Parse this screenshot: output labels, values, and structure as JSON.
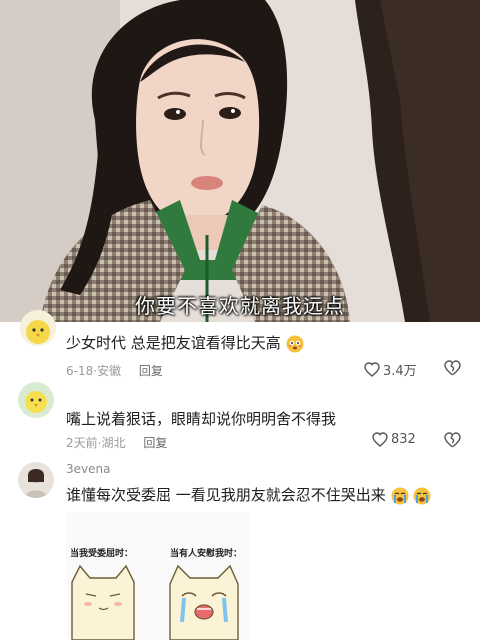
{
  "video": {
    "subtitle": "你要不喜欢就离我远点"
  },
  "comments": [
    {
      "text": "少女时代 总是把友谊看得比天高",
      "emoji": "flushed-face",
      "date": "6-18",
      "location": "安徽",
      "reply_label": "回复",
      "likes": "3.4万"
    },
    {
      "text": "嘴上说着狠话，眼睛却说你明明舍不得我",
      "date": "2天前",
      "location": "湖北",
      "reply_label": "回复",
      "likes": "832"
    },
    {
      "username": "3evena",
      "text": "谁懂每次受委屈 一看见我朋友就会忍不住哭出来",
      "emoji": "crying-face",
      "meme": {
        "caption_left": "当我受委屈时：",
        "caption_right": "当有人安慰我时："
      }
    }
  ],
  "separators": {
    "dot": "·"
  },
  "colors": {
    "meta": "#9a9a9a",
    "text": "#1e1e1e",
    "heart": "#555555"
  }
}
